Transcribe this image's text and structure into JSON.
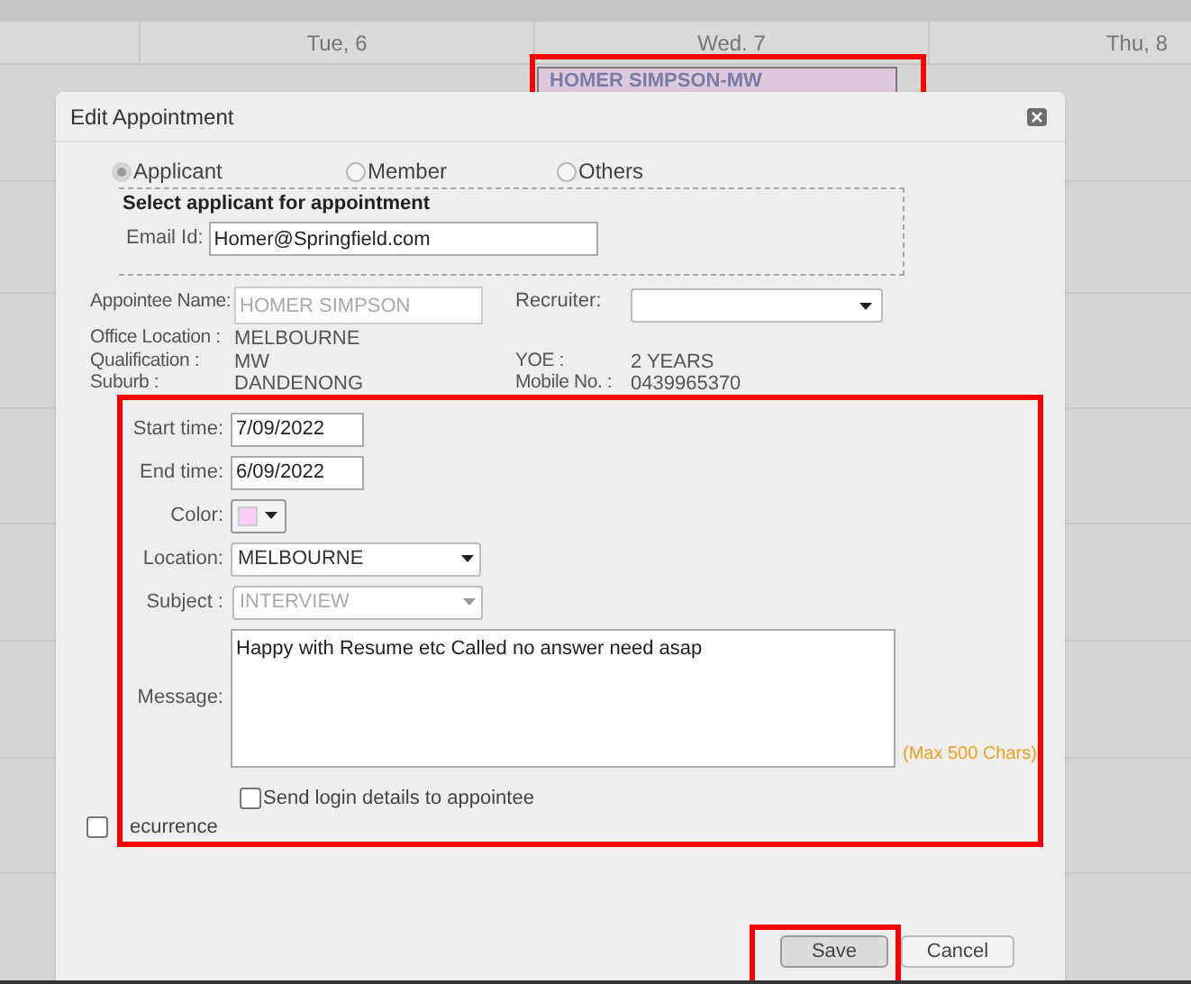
{
  "calendar": {
    "days": [
      {
        "label": "Tue, 6"
      },
      {
        "label": "Wed. 7"
      },
      {
        "label": "Thu, 8"
      }
    ],
    "event": {
      "label": "HOMER SIMPSON-MW",
      "color": "#dccadc"
    }
  },
  "dialog": {
    "title": "Edit Appointment",
    "types": [
      {
        "label": "Applicant",
        "selected": true
      },
      {
        "label": "Member",
        "selected": false
      },
      {
        "label": "Others",
        "selected": false
      }
    ],
    "applicant_group": {
      "title": "Select applicant for appointment",
      "email_label": "Email Id:",
      "email": "Homer@Springfield.com"
    },
    "appointee_name": {
      "label": "Appointee Name:",
      "value": "HOMER SIMPSON",
      "disabled": true
    },
    "recruiter": {
      "label": "Recruiter:"
    },
    "details": [
      {
        "cells": [
          {
            "label": "Office Location :",
            "value": "MELBOURNE"
          }
        ]
      },
      {
        "cells": [
          {
            "label": "Qualification :",
            "value": "MW"
          },
          {
            "label": "YOE :",
            "value": "2 YEARS"
          }
        ]
      },
      {
        "cells": [
          {
            "label": "Suburb :",
            "value": "DANDENONG"
          },
          {
            "label": "Mobile No. :",
            "value": "0439965370"
          }
        ]
      }
    ],
    "fields": [
      {
        "kind": "text",
        "label": "Start time:",
        "value": "7/09/2022"
      },
      {
        "kind": "text",
        "label": "End time:",
        "value": "6/09/2022"
      },
      {
        "kind": "color",
        "label": "Color:",
        "color": "#f8cdf8"
      },
      {
        "kind": "select",
        "label": "Location:",
        "value": "MELBOURNE",
        "disabled": false
      },
      {
        "kind": "select",
        "label": "Subject :",
        "value": "INTERVIEW",
        "disabled": true
      },
      {
        "kind": "textarea",
        "label": "Message:",
        "value": "Happy with Resume etc Called no answer need asap",
        "hint": "(Max 500 Chars)"
      }
    ],
    "send_login": {
      "label": "Send login details to appointee",
      "checked": false
    },
    "recurrence": {
      "label": "ecurrence",
      "checked": false
    },
    "buttons": [
      {
        "label": "Save"
      },
      {
        "label": "Cancel"
      }
    ]
  }
}
